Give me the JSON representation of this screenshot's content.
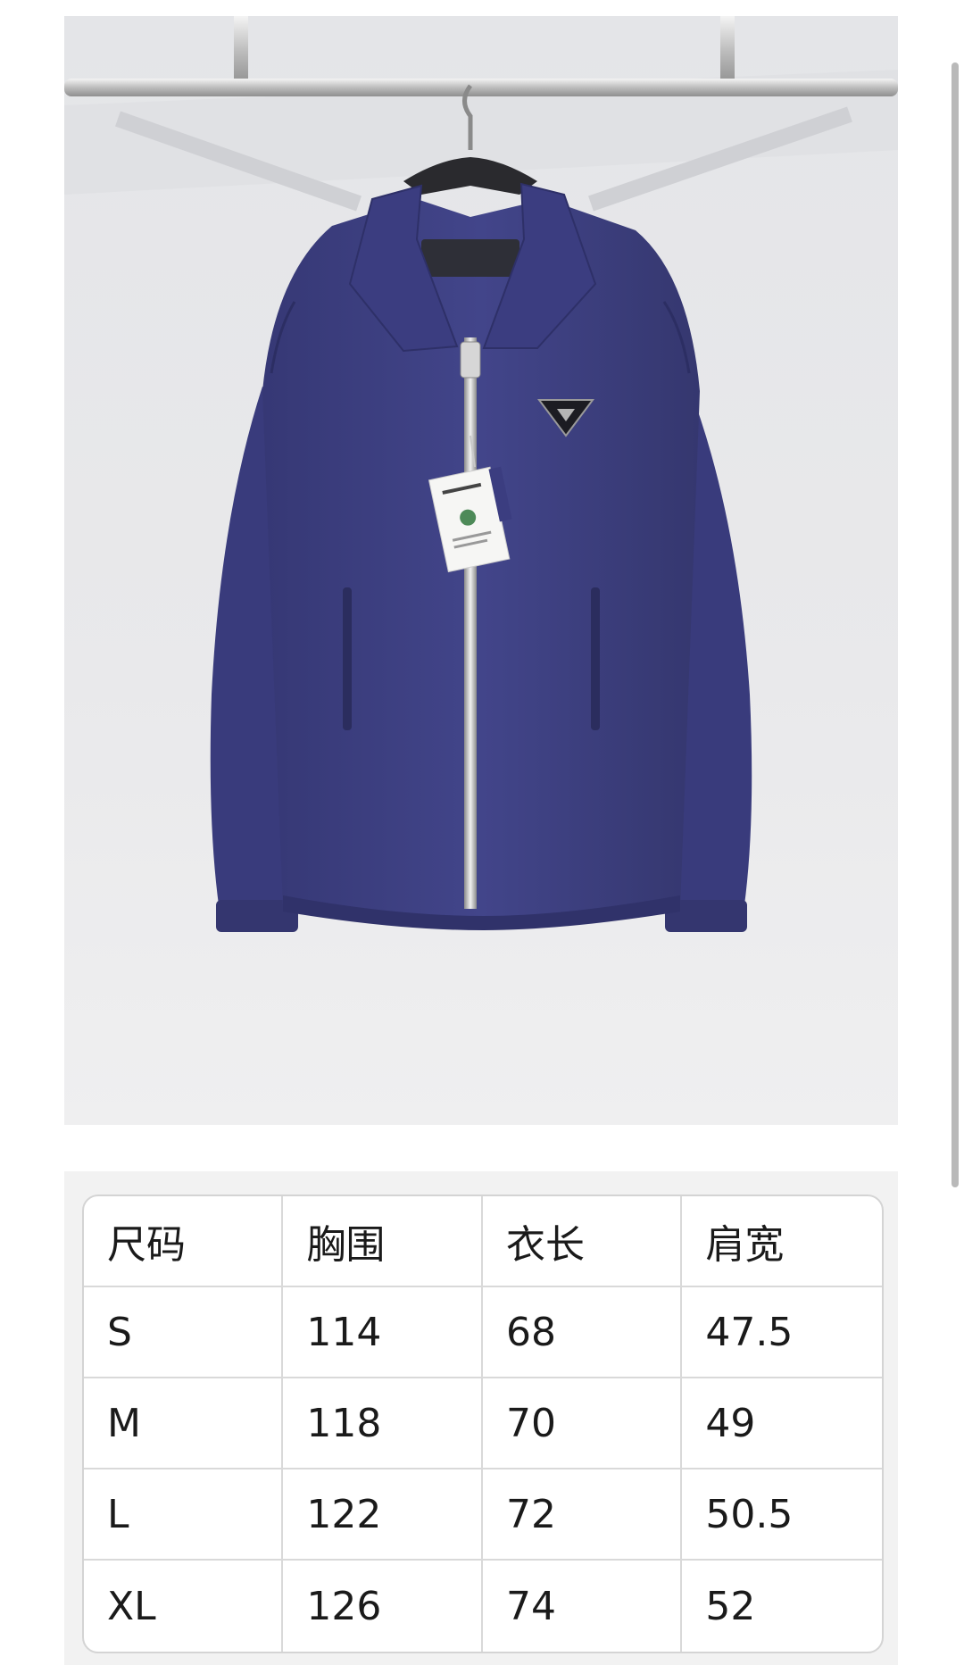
{
  "product_image": {
    "alt": "",
    "icon": "jacket-photo",
    "colors": {
      "jacket": "#3d4085",
      "background": "#e8e9eb",
      "rail": "#c9c9c9"
    }
  },
  "size_table": {
    "headers": [
      "尺码",
      "胸围",
      "衣长",
      "肩宽"
    ],
    "rows": [
      [
        "S",
        "114",
        "68",
        "47.5"
      ],
      [
        "M",
        "118",
        "70",
        "49"
      ],
      [
        "L",
        "122",
        "72",
        "50.5"
      ],
      [
        "XL",
        "126",
        "74",
        "52"
      ]
    ]
  }
}
